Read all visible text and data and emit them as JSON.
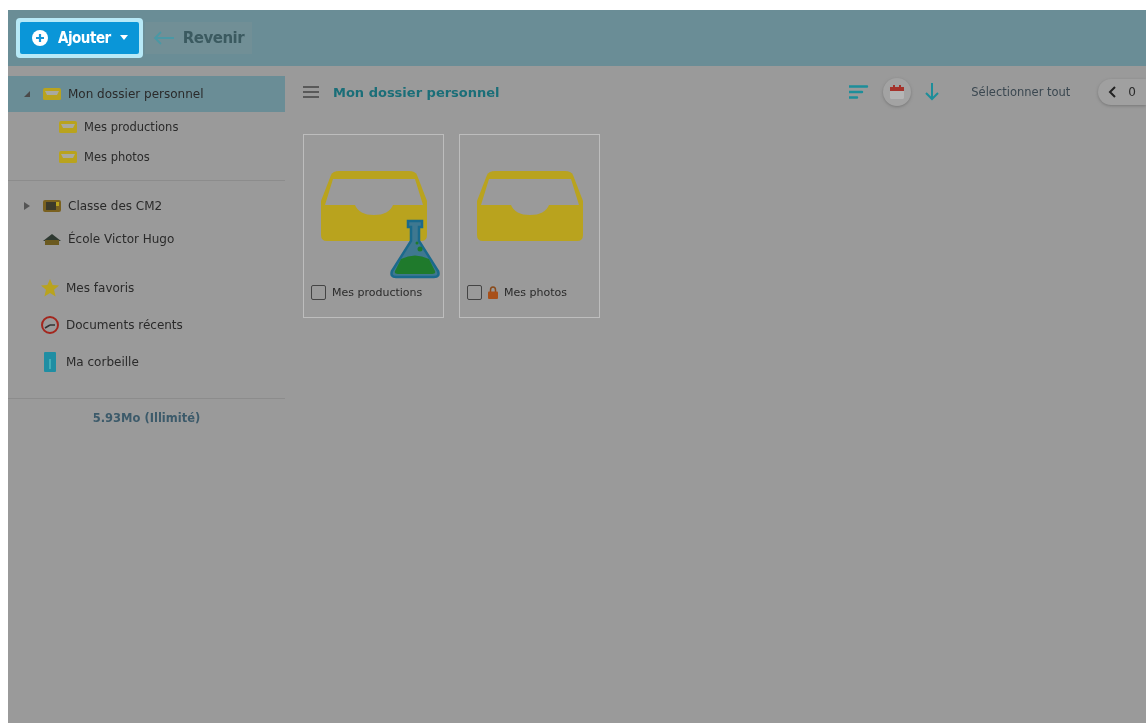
{
  "toolbar": {
    "add_button": "Ajouter",
    "back_button": "Revenir"
  },
  "sidebar": {
    "tree": [
      {
        "label": "Mon dossier personnel",
        "kind": "folder",
        "selected": true,
        "expanded": true,
        "children": [
          {
            "label": "Mes productions",
            "kind": "folder",
            "selected": false
          },
          {
            "label": "Mes photos",
            "kind": "folder",
            "selected": false
          }
        ]
      },
      {
        "label": "Classe des CM2",
        "kind": "class",
        "selected": false,
        "expanded": false
      },
      {
        "label": "École Victor Hugo",
        "kind": "school",
        "selected": false
      }
    ],
    "shortcuts": [
      {
        "label": "Mes favoris",
        "kind": "star"
      },
      {
        "label": "Documents récents",
        "kind": "recent"
      },
      {
        "label": "Ma corbeille",
        "kind": "trash"
      }
    ],
    "quota": "5.93Mo (Illimité)"
  },
  "content": {
    "title": "Mon dossier personnel",
    "select_all": "Sélectionner tout",
    "page": "0",
    "folders": [
      {
        "name": "Mes productions",
        "checked": false,
        "kind": "flask",
        "locked": false
      },
      {
        "name": "Mes photos",
        "checked": false,
        "kind": "plain",
        "locked": true
      }
    ]
  }
}
